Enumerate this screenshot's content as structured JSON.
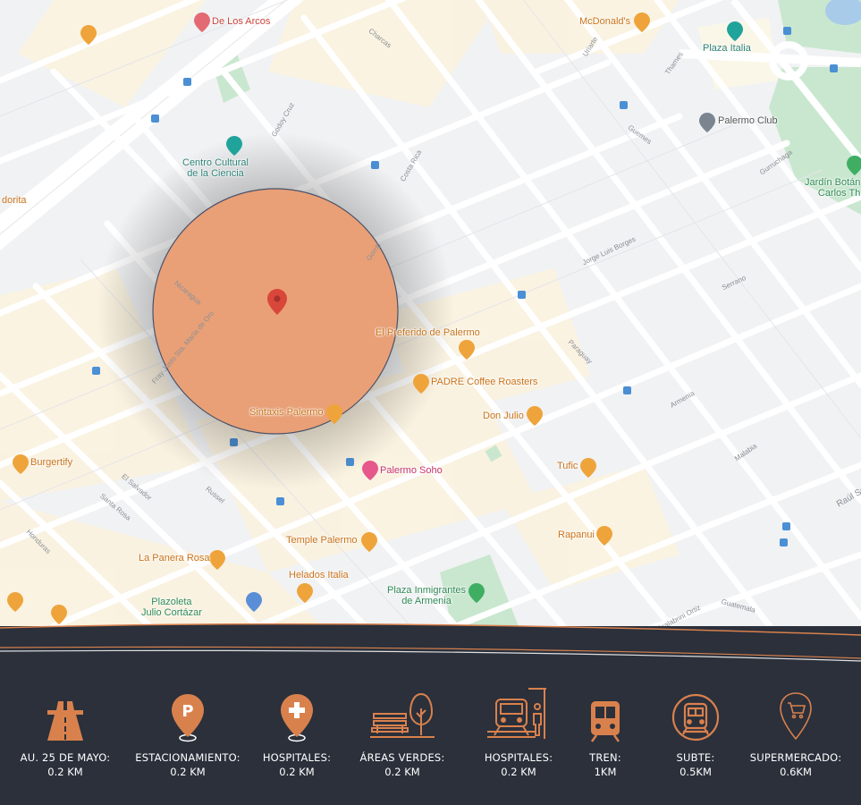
{
  "colors": {
    "accent": "#d9814d",
    "panel": "#2b303b",
    "circle": "#e9a077",
    "pin": "#d9473a",
    "poi_food": "#e8952e"
  },
  "map": {
    "pois": [
      {
        "id": "de-los-arcos",
        "label": "De Los Arcos",
        "kind": "hotel"
      },
      {
        "id": "mcdonalds",
        "label": "McDonald's",
        "kind": "food"
      },
      {
        "id": "plaza-italia",
        "label": "Plaza Italia",
        "kind": "transit"
      },
      {
        "id": "palermo-club",
        "label": "Palermo Club",
        "kind": "place"
      },
      {
        "id": "jardin-botanico",
        "label": "Jardín Botán",
        "label2": "Carlos Th",
        "kind": "park"
      },
      {
        "id": "centro-cultural",
        "label": "Centro Cultural",
        "label2": "de la Ciencia",
        "kind": "museum"
      },
      {
        "id": "dorita",
        "label": "dorita",
        "kind": "food"
      },
      {
        "id": "el-preferido",
        "label": "El Preferido de Palermo",
        "kind": "food"
      },
      {
        "id": "padre-coffee",
        "label": "PADRE Coffee Roasters",
        "kind": "food"
      },
      {
        "id": "don-julio",
        "label": "Don Julio",
        "kind": "food"
      },
      {
        "id": "sintaxis",
        "label": "Sintaxis Palermo",
        "kind": "food"
      },
      {
        "id": "burgertify",
        "label": "Burgertify",
        "kind": "food"
      },
      {
        "id": "palermo-soho",
        "label": "Palermo Soho",
        "kind": "hotel"
      },
      {
        "id": "tufic",
        "label": "Tufic",
        "kind": "food"
      },
      {
        "id": "rapanui",
        "label": "Rapanui",
        "kind": "food"
      },
      {
        "id": "temple-palermo",
        "label": "Temple Palermo",
        "kind": "food"
      },
      {
        "id": "la-panera-rosa",
        "label": "La Panera Rosa",
        "kind": "food"
      },
      {
        "id": "helados-italia",
        "label": "Helados Italia",
        "kind": "food"
      },
      {
        "id": "plaza-inmigrantes",
        "label": "Plaza Inmigrantes",
        "label2": "de Armenia",
        "kind": "park"
      },
      {
        "id": "plazoleta-cortazar",
        "label": "Plazoleta",
        "label2": "Julio Cortázar",
        "kind": "park"
      }
    ],
    "streets": [
      "Charcas",
      "Godoy Cruz",
      "Uriarte",
      "Thames",
      "Guemes",
      "Gurruchaga",
      "Costa Rica",
      "Nicaragua",
      "Honduras",
      "El Salvador",
      "Armenia",
      "Malabia",
      "Jorge Luis Borges",
      "Serrano",
      "Paraguay",
      "Guatemala",
      "Scalabrini Ortiz",
      "Raúl Sc",
      "Santa Rosa",
      "Russel",
      "Fray Justo Sta. María de Oro",
      "Gorriti"
    ]
  },
  "amenities": [
    {
      "label": "AU. 25 DE MAYO:",
      "value": "0.2 KM",
      "icon": "highway-icon"
    },
    {
      "label": "ESTACIONAMIENTO:",
      "value": "0.2 KM",
      "icon": "parking-icon"
    },
    {
      "label": "HOSPITALES:",
      "value": "0.2 KM",
      "icon": "hospital-icon"
    },
    {
      "label": "ÁREAS VERDES:",
      "value": "0.2 KM",
      "icon": "park-bench-icon"
    },
    {
      "label": "HOSPITALES:",
      "value": "0.2 KM",
      "icon": "train-station-icon"
    },
    {
      "label": "TREN:",
      "value": "1KM",
      "icon": "train-icon"
    },
    {
      "label": "SUBTE:",
      "value": "0.5KM",
      "icon": "subway-icon"
    },
    {
      "label": "SUPERMERCADO:",
      "value": "0.6KM",
      "icon": "supermarket-icon"
    }
  ]
}
